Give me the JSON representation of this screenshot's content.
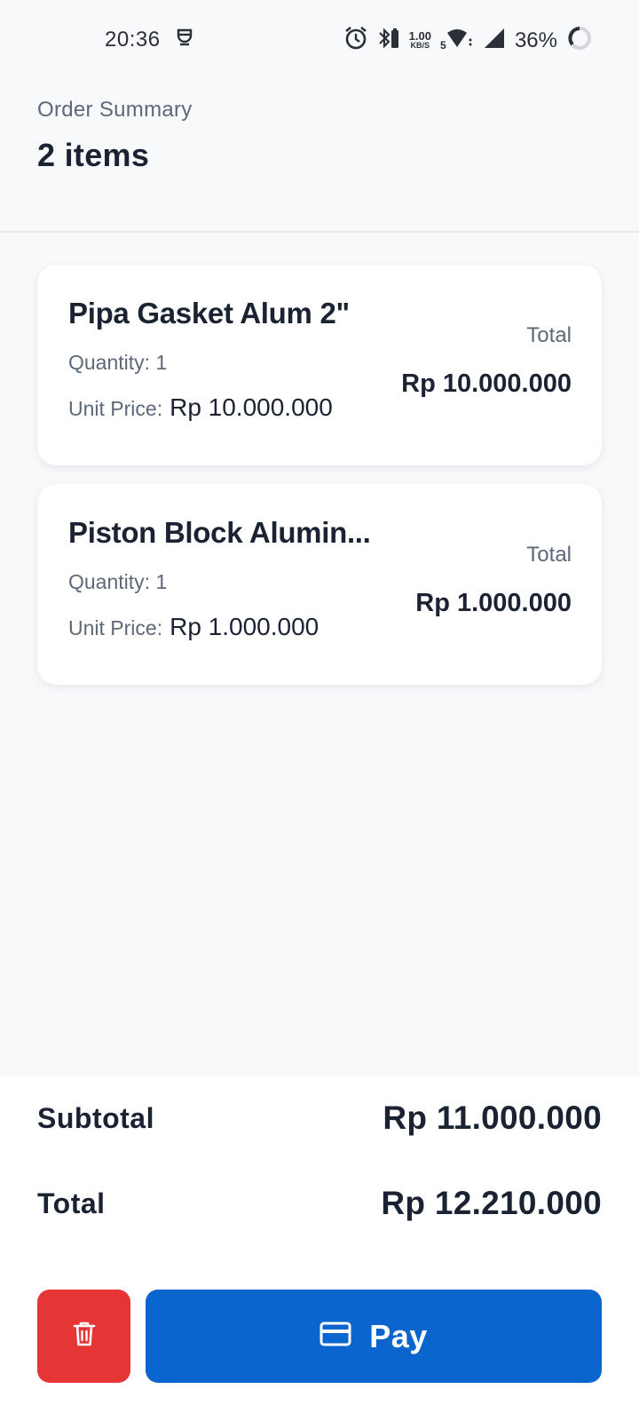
{
  "status_bar": {
    "time": "20:36",
    "net_speed_value": "1.00",
    "net_speed_unit": "KB/S",
    "battery": "36%"
  },
  "header": {
    "label": "Order Summary",
    "count": "2 items"
  },
  "items": [
    {
      "name": "Pipa Gasket Alum 2\"",
      "quantity_label": "Quantity:",
      "quantity": "1",
      "unit_price_label": "Unit Price:",
      "unit_price": "Rp 10.000.000",
      "total_label": "Total",
      "total": "Rp 10.000.000"
    },
    {
      "name": "Piston Block Alumin...",
      "quantity_label": "Quantity:",
      "quantity": "1",
      "unit_price_label": "Unit Price:",
      "unit_price": "Rp 1.000.000",
      "total_label": "Total",
      "total": "Rp 1.000.000"
    }
  ],
  "summary": {
    "subtotal_label": "Subtotal",
    "subtotal": "Rp 11.000.000",
    "total_label": "Total",
    "total": "Rp 12.210.000"
  },
  "actions": {
    "pay_label": "Pay",
    "delete_icon": "trash-icon",
    "pay_icon": "credit-card-icon"
  },
  "colors": {
    "delete": "#e53535",
    "pay": "#0a66cc",
    "background": "#f7f9fb",
    "text": "#1b2333"
  }
}
